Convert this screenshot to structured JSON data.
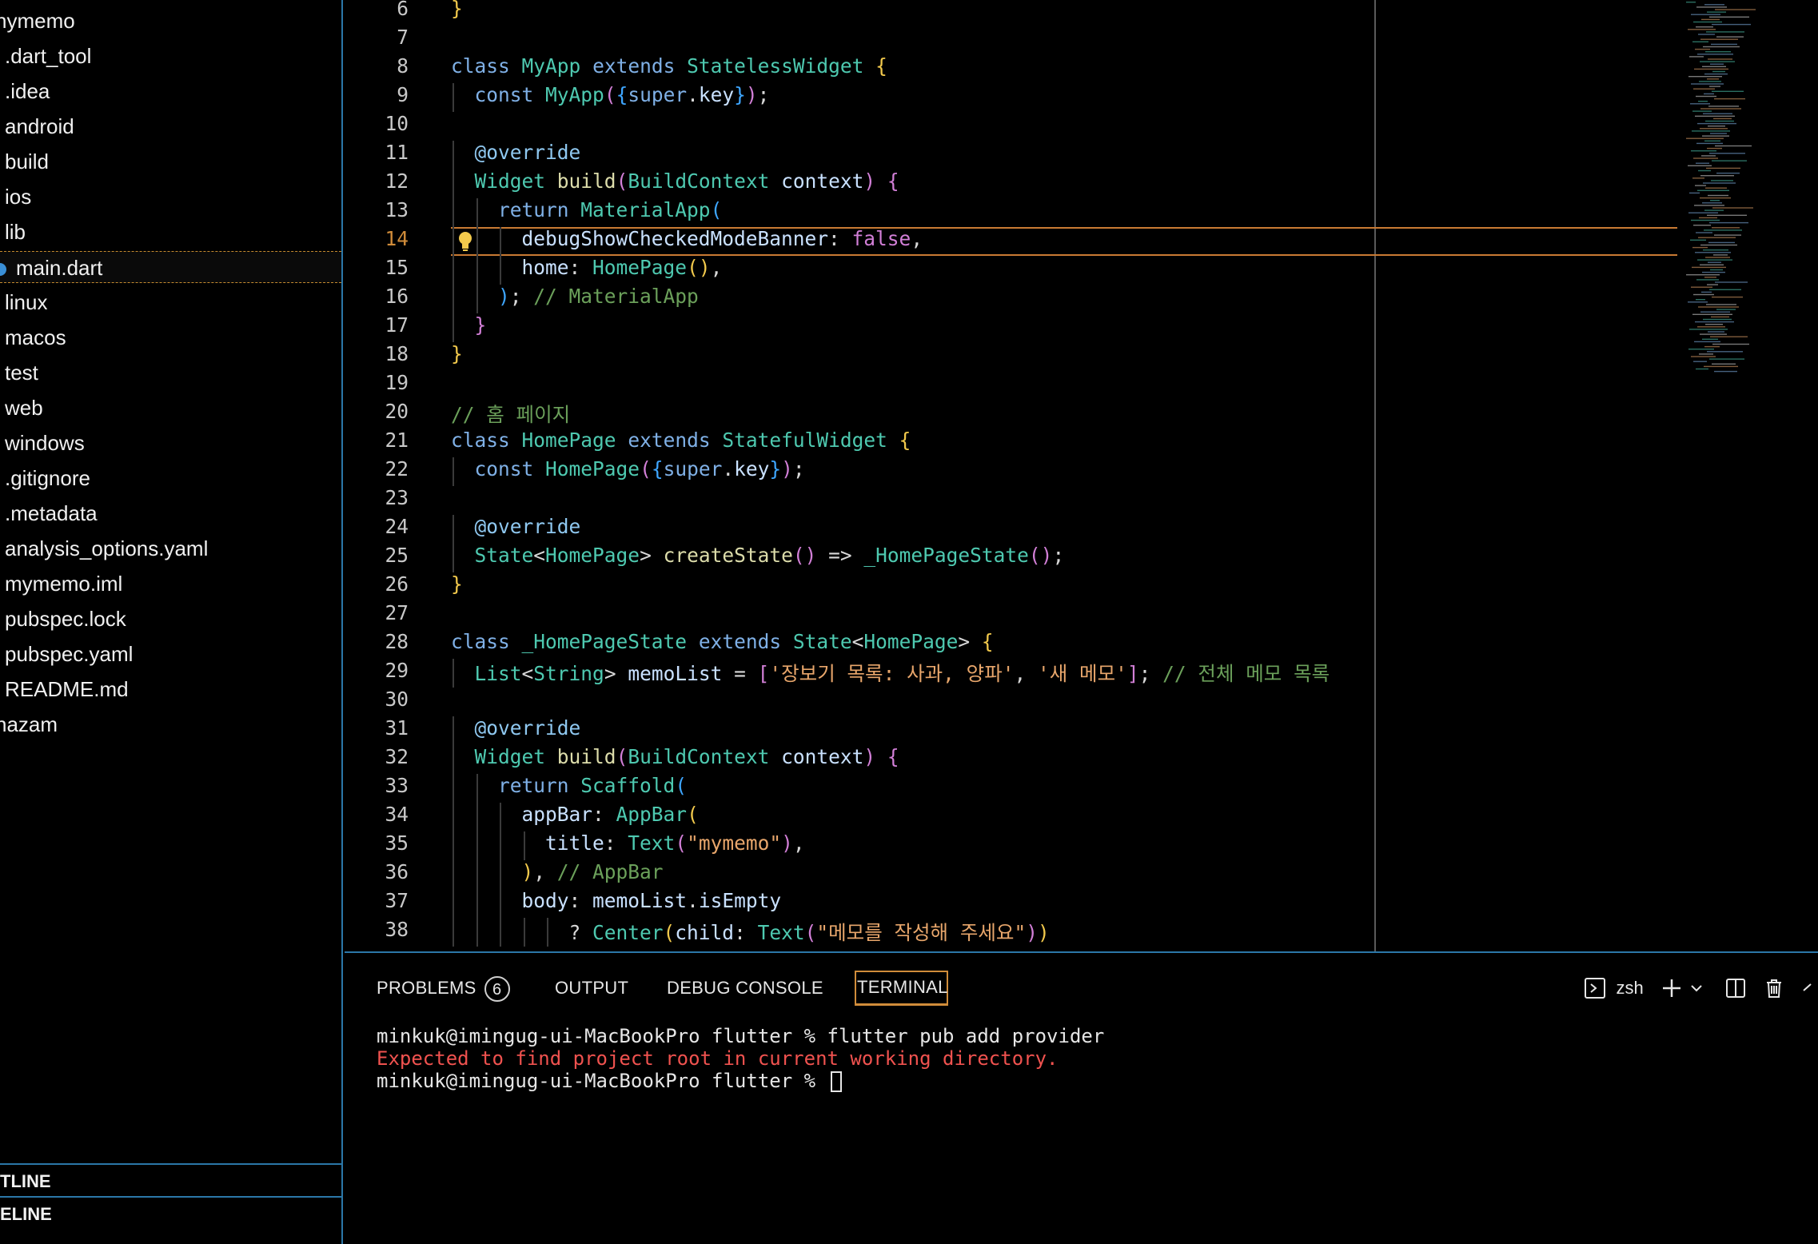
{
  "explorer": {
    "items": [
      {
        "label": "nymemo",
        "indent": 0
      },
      {
        "label": ".dart_tool",
        "indent": 1
      },
      {
        "label": ".idea",
        "indent": 1
      },
      {
        "label": "android",
        "indent": 1
      },
      {
        "label": "build",
        "indent": 1
      },
      {
        "label": "ios",
        "indent": 1
      },
      {
        "label": "lib",
        "indent": 1
      },
      {
        "label": "main.dart",
        "indent": 2,
        "selected": true
      },
      {
        "label": "linux",
        "indent": 1
      },
      {
        "label": "macos",
        "indent": 1
      },
      {
        "label": "test",
        "indent": 1
      },
      {
        "label": "web",
        "indent": 1
      },
      {
        "label": "windows",
        "indent": 1
      },
      {
        "label": ".gitignore",
        "indent": 1
      },
      {
        "label": ".metadata",
        "indent": 1
      },
      {
        "label": "analysis_options.yaml",
        "indent": 1
      },
      {
        "label": "mymemo.iml",
        "indent": 1
      },
      {
        "label": "pubspec.lock",
        "indent": 1
      },
      {
        "label": "pubspec.yaml",
        "indent": 1
      },
      {
        "label": "README.md",
        "indent": 1
      },
      {
        "label": "hazam",
        "indent": 0
      }
    ],
    "outline_label": "TLINE",
    "timeline_label": "ELINE"
  },
  "editor": {
    "active_line": 14,
    "lines": [
      {
        "n": "6",
        "code": "}"
      },
      {
        "n": "7",
        "code": ""
      },
      {
        "n": "8",
        "code": "class MyApp extends StatelessWidget {"
      },
      {
        "n": "9",
        "code": "  const MyApp({super.key});"
      },
      {
        "n": "10",
        "code": ""
      },
      {
        "n": "11",
        "code": "  @override"
      },
      {
        "n": "12",
        "code": "  Widget build(BuildContext context) {"
      },
      {
        "n": "13",
        "code": "    return MaterialApp("
      },
      {
        "n": "14",
        "code": "      debugShowCheckedModeBanner: false,"
      },
      {
        "n": "15",
        "code": "      home: HomePage(),"
      },
      {
        "n": "16",
        "code": "    ); // MaterialApp"
      },
      {
        "n": "17",
        "code": "  }"
      },
      {
        "n": "18",
        "code": "}"
      },
      {
        "n": "19",
        "code": ""
      },
      {
        "n": "20",
        "code": "// 홈 페이지"
      },
      {
        "n": "21",
        "code": "class HomePage extends StatefulWidget {"
      },
      {
        "n": "22",
        "code": "  const HomePage({super.key});"
      },
      {
        "n": "23",
        "code": ""
      },
      {
        "n": "24",
        "code": "  @override"
      },
      {
        "n": "25",
        "code": "  State<HomePage> createState() => _HomePageState();"
      },
      {
        "n": "26",
        "code": "}"
      },
      {
        "n": "27",
        "code": ""
      },
      {
        "n": "28",
        "code": "class _HomePageState extends State<HomePage> {"
      },
      {
        "n": "29",
        "code": "  List<String> memoList = ['장보기 목록: 사과, 양파', '새 메모']; // 전체 메모 목록"
      },
      {
        "n": "30",
        "code": ""
      },
      {
        "n": "31",
        "code": "  @override"
      },
      {
        "n": "32",
        "code": "  Widget build(BuildContext context) {"
      },
      {
        "n": "33",
        "code": "    return Scaffold("
      },
      {
        "n": "34",
        "code": "      appBar: AppBar("
      },
      {
        "n": "35",
        "code": "        title: Text(\"mymemo\"),"
      },
      {
        "n": "36",
        "code": "      ), // AppBar"
      },
      {
        "n": "37",
        "code": "      body: memoList.isEmpty"
      },
      {
        "n": "38",
        "code": "          ? Center(child: Text(\"메모를 작성해 주세요\"))"
      }
    ]
  },
  "panel": {
    "tabs": {
      "problems": "PROBLEMS",
      "problems_count": "6",
      "output": "OUTPUT",
      "debug_console": "DEBUG CONSOLE",
      "terminal": "TERMINAL"
    },
    "shell_label": "zsh",
    "terminal_lines": {
      "line1": "minkuk@imingug-ui-MacBookPro flutter % flutter pub add provider",
      "line2": "Expected to find project root in current working directory.",
      "line3": "minkuk@imingug-ui-MacBookPro flutter % "
    }
  },
  "colors": {
    "accent_blue": "#2b77a8",
    "active_tab_orange": "#d08c3a",
    "error_red": "#f0524f"
  }
}
